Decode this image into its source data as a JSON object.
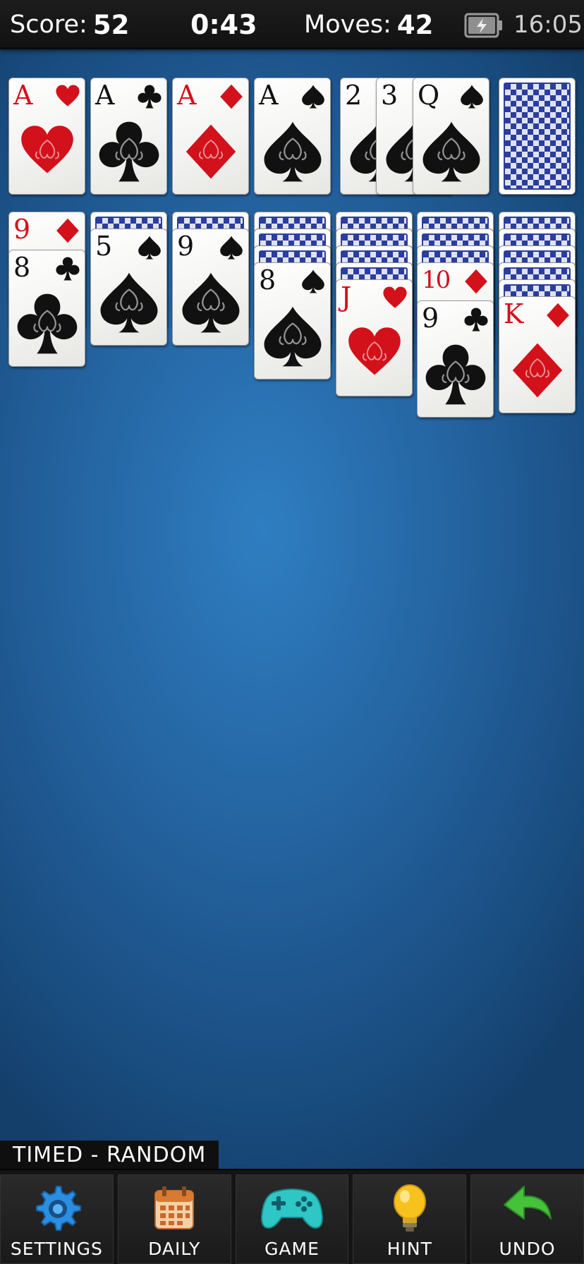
{
  "status": {
    "score_label": "Score:",
    "score_value": "52",
    "timer": "0:43",
    "moves_label": "Moves:",
    "moves_value": "42",
    "clock": "16:05",
    "battery_icon": "battery-charging-icon"
  },
  "colors": {
    "felt": "#2a6dad",
    "red_suit": "#d2111b",
    "black_suit": "#111111",
    "card_back": "#2b3e9e"
  },
  "foundations": [
    {
      "rank": "A",
      "suit": "hearts"
    },
    {
      "rank": "A",
      "suit": "clubs"
    },
    {
      "rank": "A",
      "suit": "diamonds"
    },
    {
      "rank": "A",
      "suit": "spades"
    }
  ],
  "waste": [
    {
      "rank": "2",
      "suit": "spades"
    },
    {
      "rank": "3",
      "suit": "spades"
    },
    {
      "rank": "Q",
      "suit": "spades"
    }
  ],
  "stock": {
    "face_down": true
  },
  "tableau": [
    {
      "hidden": 0,
      "cards": [
        {
          "rank": "9",
          "suit": "diamonds"
        },
        {
          "rank": "8",
          "suit": "clubs"
        }
      ]
    },
    {
      "hidden": 1,
      "cards": [
        {
          "rank": "5",
          "suit": "spades"
        }
      ]
    },
    {
      "hidden": 1,
      "cards": [
        {
          "rank": "9",
          "suit": "spades"
        }
      ]
    },
    {
      "hidden": 3,
      "cards": [
        {
          "rank": "8",
          "suit": "spades"
        }
      ]
    },
    {
      "hidden": 4,
      "cards": [
        {
          "rank": "J",
          "suit": "hearts"
        }
      ]
    },
    {
      "hidden": 3,
      "cards": [
        {
          "rank": "10",
          "suit": "diamonds"
        },
        {
          "rank": "9",
          "suit": "clubs"
        }
      ]
    },
    {
      "hidden": 5,
      "cards": [
        {
          "rank": "K",
          "suit": "diamonds"
        }
      ]
    }
  ],
  "mode_label": "TIMED - RANDOM",
  "toolbar": [
    {
      "label": "SETTINGS",
      "icon": "gear-icon"
    },
    {
      "label": "DAILY",
      "icon": "calendar-icon"
    },
    {
      "label": "GAME",
      "icon": "gamepad-icon"
    },
    {
      "label": "HINT",
      "icon": "lightbulb-icon"
    },
    {
      "label": "UNDO",
      "icon": "undo-arrow-icon"
    }
  ]
}
